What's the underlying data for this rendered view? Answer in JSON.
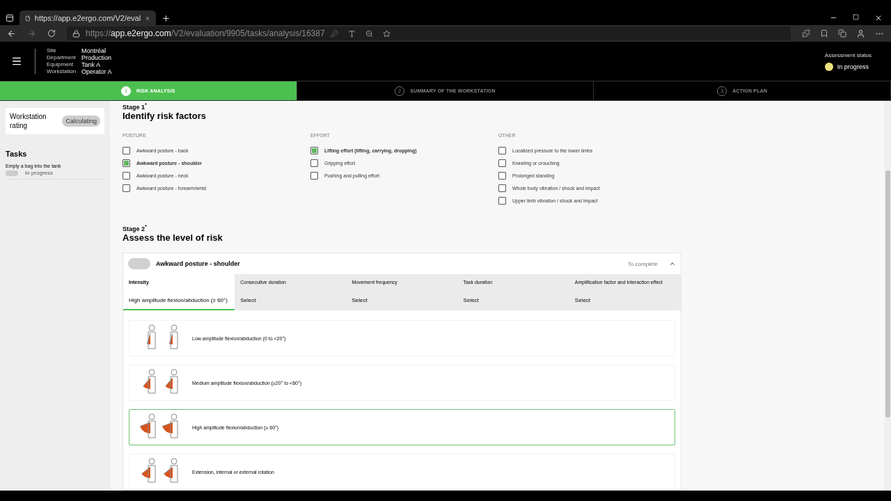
{
  "browser": {
    "tab_title": "https://app.e2ergo.com/V2/eval",
    "url_prefix": "https://",
    "url_host": "app.e2ergo.com",
    "url_path": "/V2/evaluation/9905/tasks/analysis/16387"
  },
  "header": {
    "fields": [
      {
        "label": "Site",
        "value": "Montréal"
      },
      {
        "label": "Department",
        "value": "Production"
      },
      {
        "label": "Equipment",
        "value": "Tank A"
      },
      {
        "label": "Workstation",
        "value": "Operator A"
      }
    ],
    "status_label": "Assessment status",
    "status": "In progress"
  },
  "steps": [
    {
      "number": "1",
      "label": "RISK ANALYSIS",
      "selected": true
    },
    {
      "number": "2",
      "label": "SUMMARY OF THE WORKSTATION",
      "selected": false
    },
    {
      "number": "3",
      "label": "ACTION PLAN",
      "selected": false
    }
  ],
  "sidebar": {
    "rating_label": "Workstation rating",
    "rating_value": "Calculating",
    "tasks_title": "Tasks",
    "tasks": [
      {
        "name": "Empty a bag into the tank",
        "status": "In progress",
        "on": false
      }
    ]
  },
  "stage1": {
    "label": "Stage 1$^{*}$",
    "title": "Identify risk factors",
    "groups": [
      {
        "title": "POSTURE",
        "items": [
          {
            "label": "Awkward posture - back",
            "checked": false
          },
          {
            "label": "Awkward posture - shoulder",
            "checked": true
          },
          {
            "label": "Awkward posture - neck",
            "checked": false
          },
          {
            "label": "Awkward posture - forearm/wrist",
            "checked": false
          }
        ]
      },
      {
        "title": "EFFORT",
        "items": [
          {
            "label": "Lifting effort (lifting, carrying, dropping)",
            "checked": true
          },
          {
            "label": "Gripping effort",
            "checked": false
          },
          {
            "label": "Pushing and pulling effort",
            "checked": false
          }
        ]
      },
      {
        "title": "OTHER",
        "items": [
          {
            "label": "Localized pressure to the lower limbs",
            "checked": false
          },
          {
            "label": "Kneeling or crouching",
            "checked": false
          },
          {
            "label": "Prolonged standing",
            "checked": false
          },
          {
            "label": "Whole body vibration / shock and impact",
            "checked": false
          },
          {
            "label": "Upper limb vibration / shock and impact",
            "checked": false
          }
        ]
      }
    ]
  },
  "stage2": {
    "label": "Stage 2$^{*}$",
    "title": "Assess the level of risk",
    "factor": {
      "name": "Awkward posture - shoulder",
      "status": "To complete",
      "on": false,
      "expanded": true,
      "tabs": [
        {
          "label": "Intensity",
          "value": "High amplitude flexion/abduction (≥ 60°)",
          "selected": true
        },
        {
          "label": "Consecutive duration",
          "value": "Select",
          "selected": false
        },
        {
          "label": "Movement frequency",
          "value": "Select",
          "selected": false
        },
        {
          "label": "Task duration",
          "value": "Select",
          "selected": false
        },
        {
          "label": "Amplification factor and interaction effect",
          "value": "Select",
          "selected": false
        }
      ],
      "options": [
        {
          "label": "Low amplitude flexion/abduction (0 to <20°)",
          "selected": false
        },
        {
          "label": "Medium amplitude flexion/abduction (≥20° to <60°)",
          "selected": false
        },
        {
          "label": "High amplitude flexion/abduction (≥ 60°)",
          "selected": true
        },
        {
          "label": "Extension, internal or external rotation",
          "selected": false
        }
      ]
    }
  }
}
